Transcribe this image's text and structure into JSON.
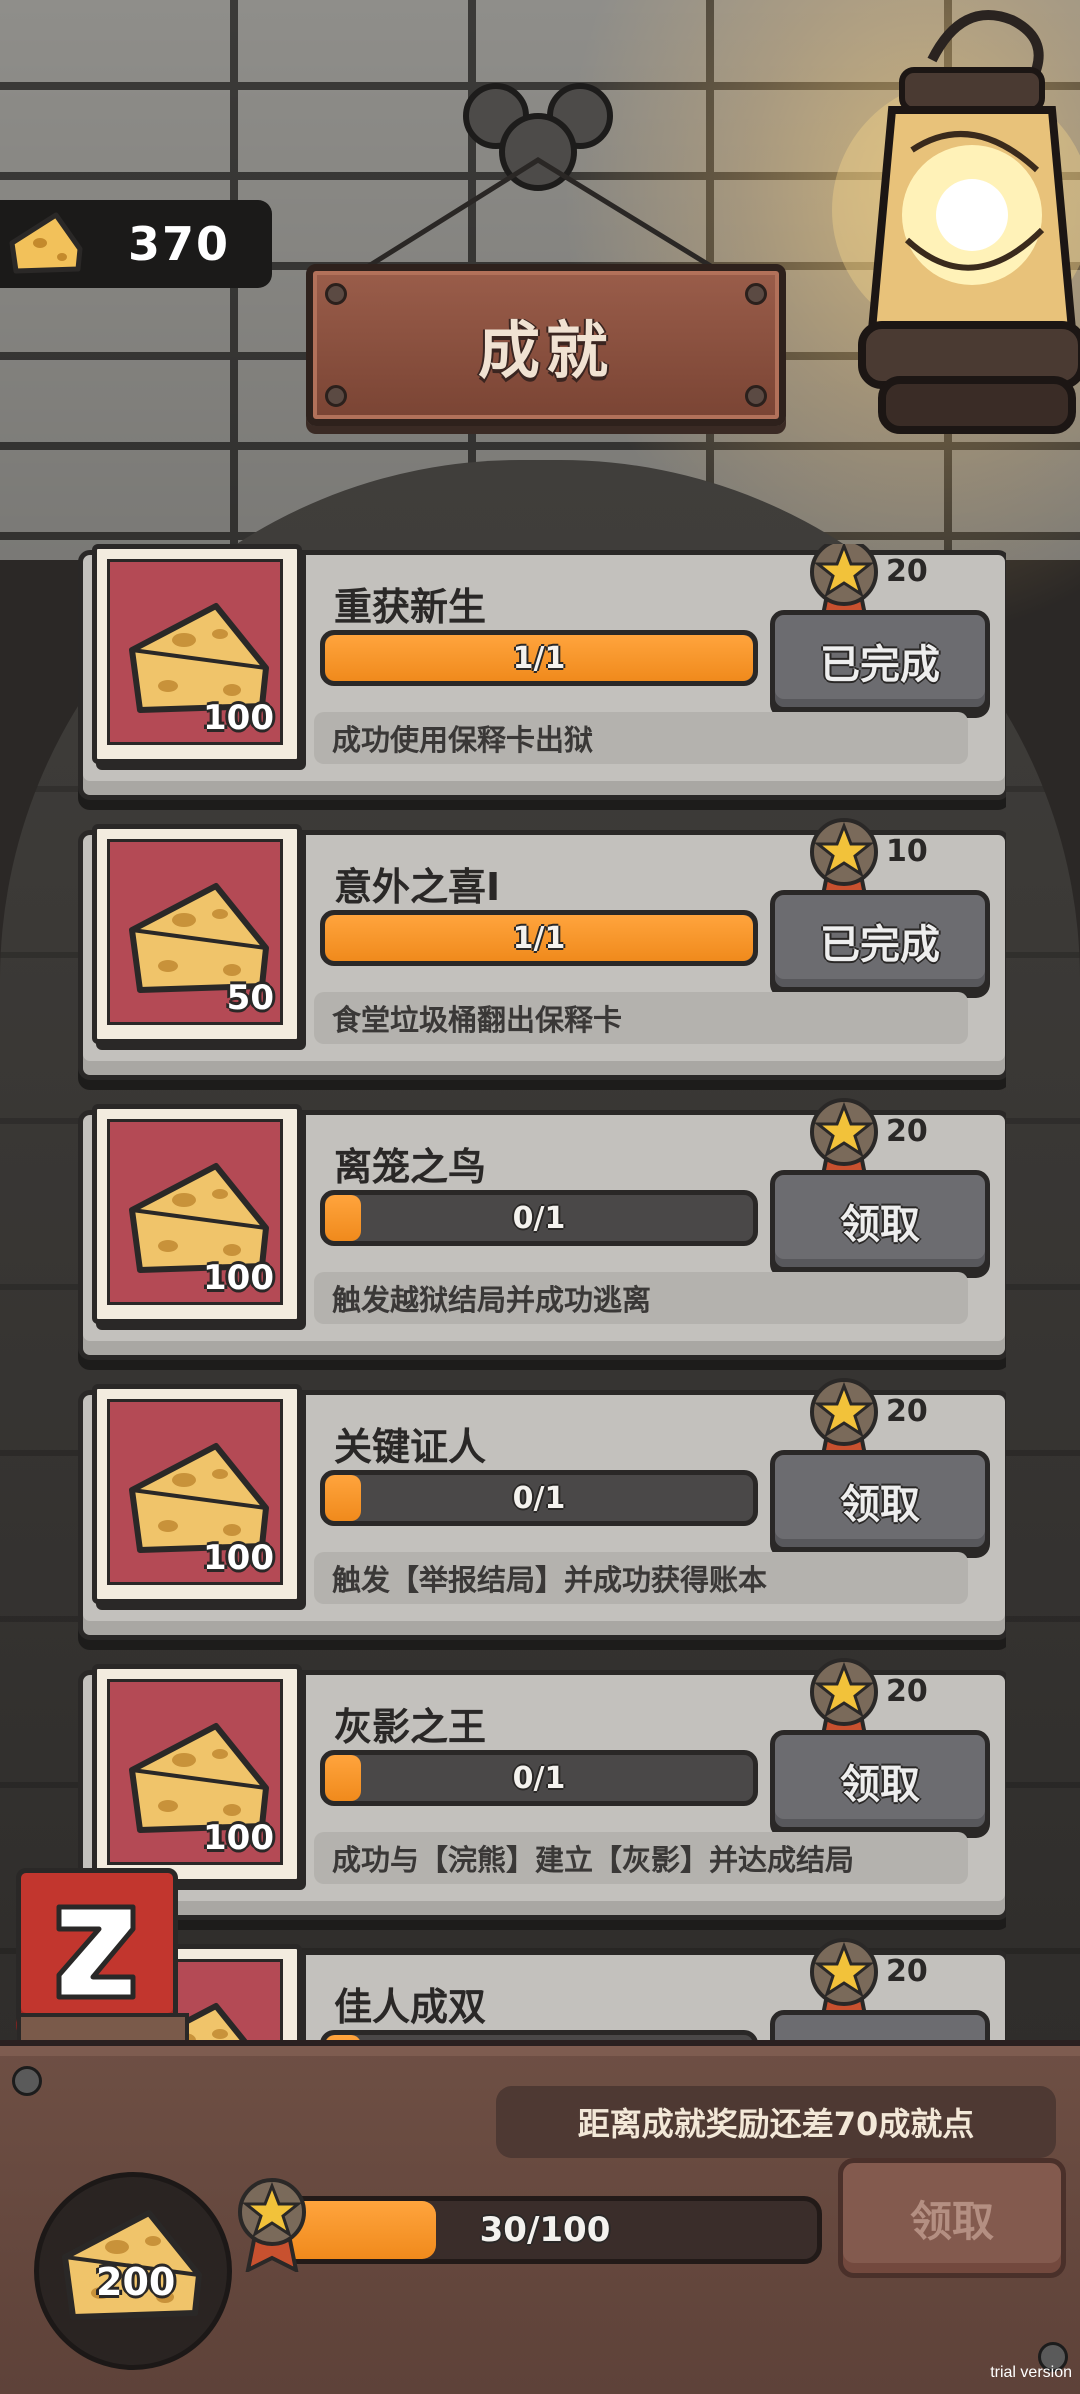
{
  "title": "成就",
  "currency": {
    "icon": "cheese-icon",
    "value": "370"
  },
  "achievements": [
    {
      "name": "重获新生",
      "reward": "100",
      "points": "20",
      "progress_text": "1/1",
      "progress": 1.0,
      "button": "已完成",
      "description": "成功使用保释卡出狱"
    },
    {
      "name": "意外之喜I",
      "reward": "50",
      "points": "10",
      "progress_text": "1/1",
      "progress": 1.0,
      "button": "已完成",
      "description": "食堂垃圾桶翻出保释卡"
    },
    {
      "name": "离笼之鸟",
      "reward": "100",
      "points": "20",
      "progress_text": "0/1",
      "progress": 0.0,
      "button": "领取",
      "description": "触发越狱结局并成功逃离"
    },
    {
      "name": "关键证人",
      "reward": "100",
      "points": "20",
      "progress_text": "0/1",
      "progress": 0.0,
      "button": "领取",
      "description": "触发【举报结局】并成功获得账本"
    },
    {
      "name": "灰影之王",
      "reward": "100",
      "points": "20",
      "progress_text": "0/1",
      "progress": 0.0,
      "button": "领取",
      "description": "成功与【浣熊】建立【灰影】并达成结局"
    },
    {
      "name": "佳人成双",
      "reward": "",
      "points": "20",
      "progress_text": "",
      "progress": 0.0,
      "button": "",
      "description": ""
    }
  ],
  "side_badge": {
    "icon": "z-letter-icon"
  },
  "bottom": {
    "hint": "距离成就奖励还差70成就点",
    "reward": "200",
    "progress_text": "30/100",
    "progress": 0.3,
    "button": "领取"
  },
  "watermark": "trial version",
  "colors": {
    "accent_orange": "#f5951f",
    "card": "#c3c1bd",
    "button_gray": "#6c6c70",
    "reward_red": "#b44a55",
    "wood": "#6e4f44"
  }
}
